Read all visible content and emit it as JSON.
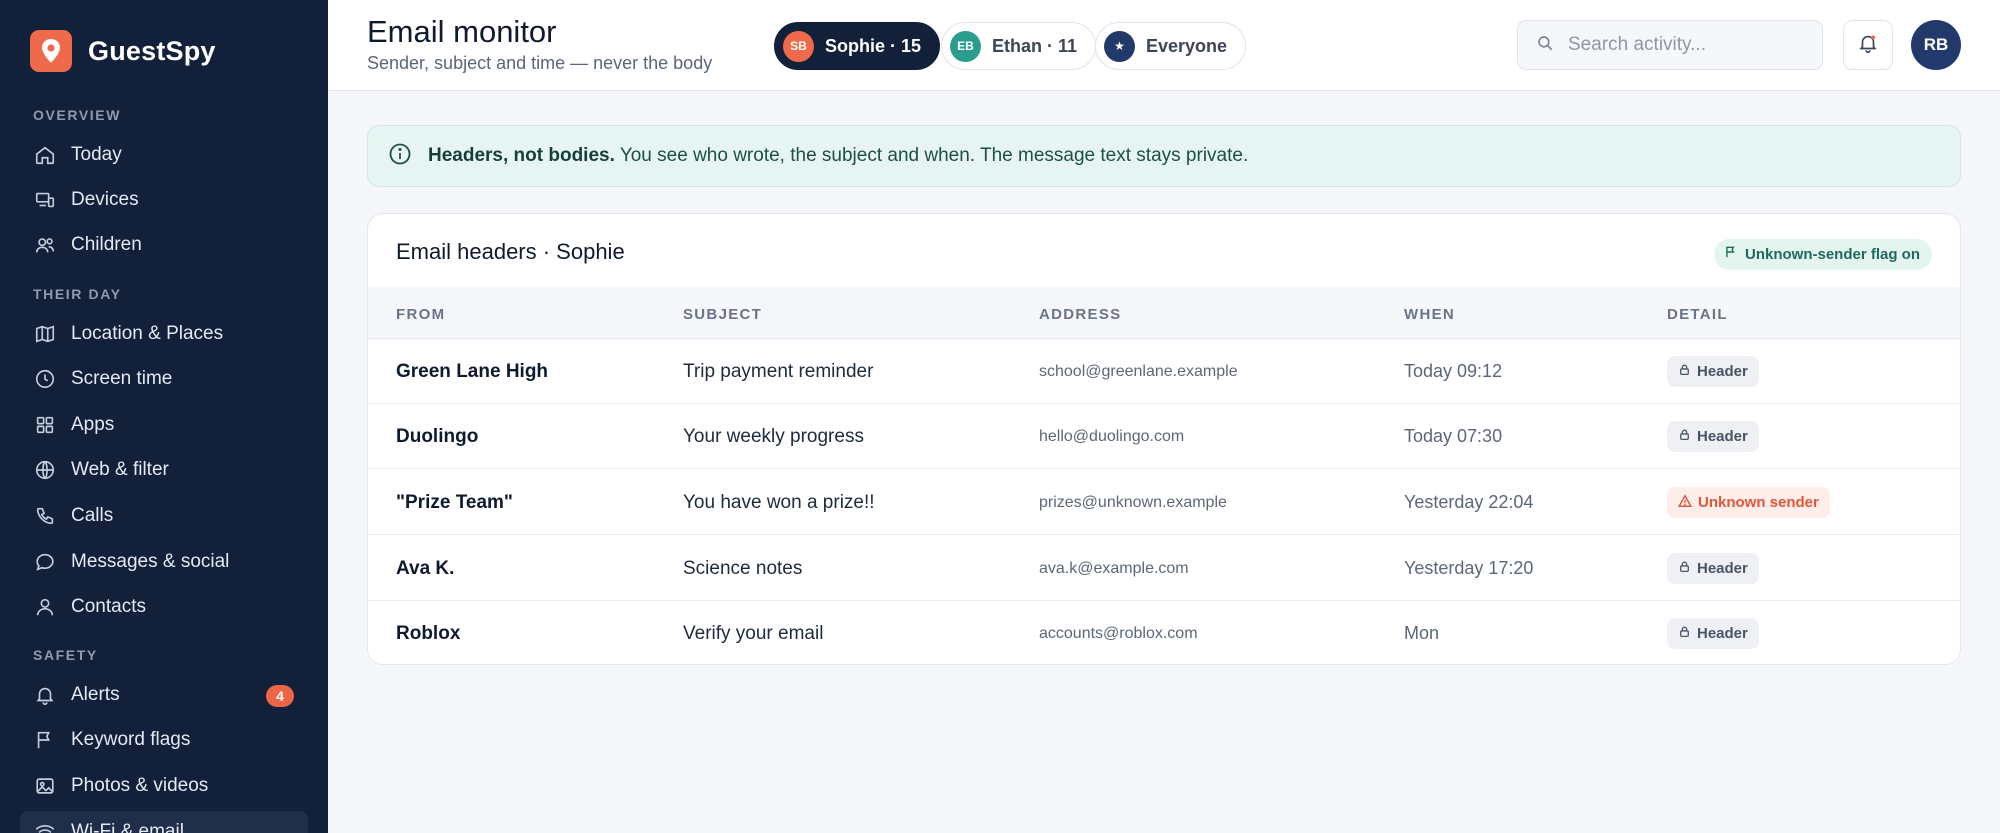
{
  "app": {
    "name": "GuestSpy"
  },
  "sidebar": {
    "sections": [
      {
        "label": "OVERVIEW"
      },
      {
        "label": "THEIR DAY"
      },
      {
        "label": "SAFETY"
      }
    ],
    "items": [
      {
        "label": "Today",
        "icon": "home-icon"
      },
      {
        "label": "Devices",
        "icon": "devices-icon"
      },
      {
        "label": "Children",
        "icon": "users-icon"
      },
      {
        "label": "Location & Places",
        "icon": "map-icon"
      },
      {
        "label": "Screen time",
        "icon": "clock-icon"
      },
      {
        "label": "Apps",
        "icon": "grid-icon"
      },
      {
        "label": "Web & filter",
        "icon": "globe-icon"
      },
      {
        "label": "Calls",
        "icon": "phone-icon"
      },
      {
        "label": "Messages & social",
        "icon": "chat-icon"
      },
      {
        "label": "Contacts",
        "icon": "user-icon"
      },
      {
        "label": "Alerts",
        "icon": "bell-icon",
        "badge": "4"
      },
      {
        "label": "Keyword flags",
        "icon": "flag-icon"
      },
      {
        "label": "Photos & videos",
        "icon": "image-icon"
      },
      {
        "label": "Wi-Fi & email",
        "icon": "wifi-icon",
        "active": true
      }
    ]
  },
  "header": {
    "title": "Email monitor",
    "subtitle": "Sender, subject and time — never the body",
    "profiles": [
      {
        "initials": "SB",
        "label": "Sophie · 15",
        "color": "#ee6a4b",
        "active": true
      },
      {
        "initials": "EB",
        "label": "Ethan · 11",
        "color": "#2a9d8f",
        "active": false
      },
      {
        "initials": "★",
        "label": "Everyone",
        "color": "#213a6b",
        "active": false
      }
    ],
    "search_placeholder": "Search activity...",
    "user_initials": "RB"
  },
  "banner": {
    "bold": "Headers, not bodies.",
    "text": "You see who wrote, the subject and when. The message text stays private."
  },
  "card": {
    "title": "Email headers · Sophie",
    "flag_label": "Unknown-sender flag on",
    "columns": [
      "FROM",
      "SUBJECT",
      "ADDRESS",
      "WHEN",
      "DETAIL"
    ],
    "rows": [
      {
        "from": "Green Lane High",
        "subject": "Trip payment reminder",
        "address": "school@greenlane.example",
        "when": "Today 09:12",
        "detail": "Header",
        "type": "header"
      },
      {
        "from": "Duolingo",
        "subject": "Your weekly progress",
        "address": "hello@duolingo.com",
        "when": "Today 07:30",
        "detail": "Header",
        "type": "header"
      },
      {
        "from": "\"Prize Team\"",
        "subject": "You have won a prize!!",
        "address": "prizes@unknown.example",
        "when": "Yesterday 22:04",
        "detail": "Unknown sender",
        "type": "unknown"
      },
      {
        "from": "Ava K.",
        "subject": "Science notes",
        "address": "ava.k@example.com",
        "when": "Yesterday 17:20",
        "detail": "Header",
        "type": "header"
      },
      {
        "from": "Roblox",
        "subject": "Verify your email",
        "address": "accounts@roblox.com",
        "when": "Mon",
        "detail": "Header",
        "type": "header"
      }
    ]
  }
}
